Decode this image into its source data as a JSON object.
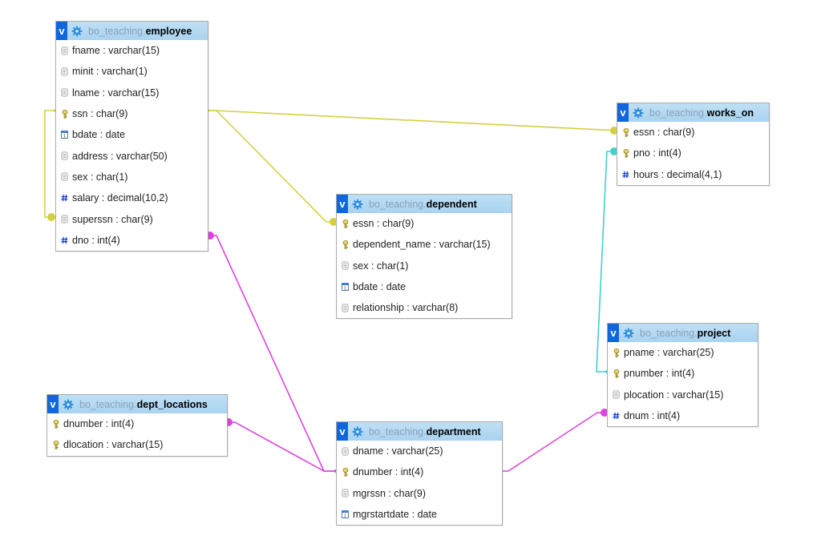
{
  "diagram": {
    "toggle_label": "v",
    "separator": ".",
    "tables": [
      {
        "id": "employee",
        "schema": "bo_teaching",
        "name": "employee",
        "columns": [
          {
            "label": "fname : varchar(15)",
            "icon": "text-column-icon"
          },
          {
            "label": "minit : varchar(1)",
            "icon": "text-column-icon"
          },
          {
            "label": "lname : varchar(15)",
            "icon": "text-column-icon"
          },
          {
            "label": "ssn : char(9)",
            "icon": "primary-key-icon"
          },
          {
            "label": "bdate : date",
            "icon": "date-column-icon"
          },
          {
            "label": "address : varchar(50)",
            "icon": "text-column-icon"
          },
          {
            "label": "sex : char(1)",
            "icon": "text-column-icon"
          },
          {
            "label": "salary : decimal(10,2)",
            "icon": "numeric-column-icon"
          },
          {
            "label": "superssn : char(9)",
            "icon": "text-column-icon"
          },
          {
            "label": "dno : int(4)",
            "icon": "numeric-column-icon"
          }
        ]
      },
      {
        "id": "works_on",
        "schema": "bo_teaching",
        "name": "works_on",
        "columns": [
          {
            "label": "essn : char(9)",
            "icon": "primary-key-icon"
          },
          {
            "label": "pno : int(4)",
            "icon": "primary-key-icon"
          },
          {
            "label": "hours : decimal(4,1)",
            "icon": "numeric-column-icon"
          }
        ]
      },
      {
        "id": "dependent",
        "schema": "bo_teaching",
        "name": "dependent",
        "columns": [
          {
            "label": "essn : char(9)",
            "icon": "primary-key-icon"
          },
          {
            "label": "dependent_name : varchar(15)",
            "icon": "primary-key-icon"
          },
          {
            "label": "sex : char(1)",
            "icon": "text-column-icon"
          },
          {
            "label": "bdate : date",
            "icon": "date-column-icon"
          },
          {
            "label": "relationship : varchar(8)",
            "icon": "text-column-icon"
          }
        ]
      },
      {
        "id": "project",
        "schema": "bo_teaching",
        "name": "project",
        "columns": [
          {
            "label": "pname : varchar(25)",
            "icon": "primary-key-icon"
          },
          {
            "label": "pnumber : int(4)",
            "icon": "primary-key-icon"
          },
          {
            "label": "plocation : varchar(15)",
            "icon": "text-column-icon"
          },
          {
            "label": "dnum : int(4)",
            "icon": "numeric-column-icon"
          }
        ]
      },
      {
        "id": "dept_locations",
        "schema": "bo_teaching",
        "name": "dept_locations",
        "columns": [
          {
            "label": "dnumber : int(4)",
            "icon": "primary-key-icon"
          },
          {
            "label": "dlocation : varchar(15)",
            "icon": "primary-key-icon"
          }
        ]
      },
      {
        "id": "department",
        "schema": "bo_teaching",
        "name": "department",
        "columns": [
          {
            "label": "dname : varchar(25)",
            "icon": "text-column-icon"
          },
          {
            "label": "dnumber : int(4)",
            "icon": "primary-key-icon"
          },
          {
            "label": "mgrssn : char(9)",
            "icon": "text-column-icon"
          },
          {
            "label": "mgrstartdate : date",
            "icon": "date-column-icon"
          }
        ]
      }
    ],
    "relations": [
      {
        "from": "employee.superssn",
        "to": "employee.ssn",
        "color": "#d4d040"
      },
      {
        "from": "works_on.essn",
        "to": "employee.ssn",
        "color": "#d4d040"
      },
      {
        "from": "dependent.essn",
        "to": "employee.ssn",
        "color": "#d4d040"
      },
      {
        "from": "works_on.pno",
        "to": "project.pnumber",
        "color": "#40d0d0"
      },
      {
        "from": "employee.dno",
        "to": "department.dnumber",
        "color": "#dd44dd"
      },
      {
        "from": "dept_locations.dnumber",
        "to": "department.dnumber",
        "color": "#dd44dd"
      },
      {
        "from": "project.dnum",
        "to": "department.dnumber",
        "color": "#dd44dd"
      }
    ]
  }
}
